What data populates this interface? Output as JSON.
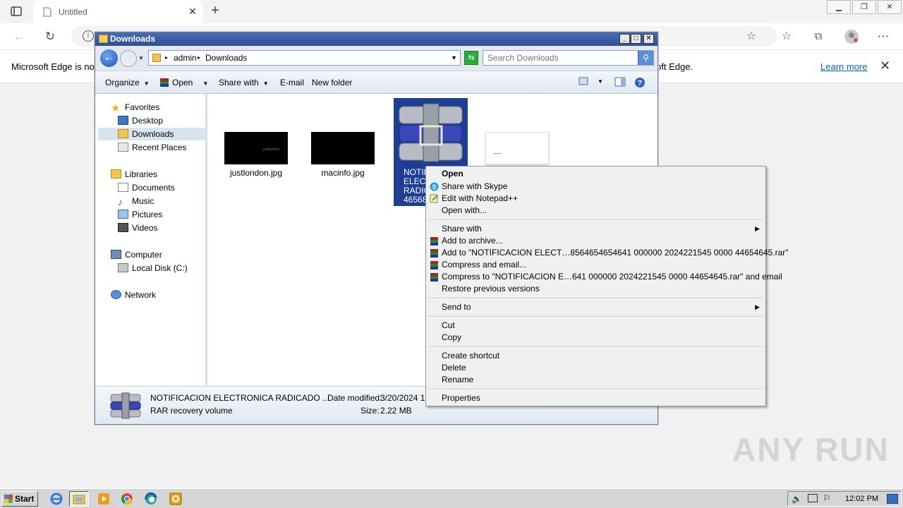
{
  "browser": {
    "tab_title": "Untitled",
    "infobar_left": "Microsoft Edge is no",
    "infobar_right": "oft Edge.",
    "learn_more": "Learn more"
  },
  "explorer": {
    "title": "Downloads",
    "breadcrumb": [
      "admin",
      "Downloads"
    ],
    "search_placeholder": "Search Downloads",
    "commands": {
      "organize": "Organize",
      "open": "Open",
      "share_with": "Share with",
      "email": "E-mail",
      "new_folder": "New folder"
    },
    "nav": {
      "favorites": "Favorites",
      "desktop": "Desktop",
      "downloads": "Downloads",
      "recent_places": "Recent Places",
      "libraries": "Libraries",
      "documents": "Documents",
      "music": "Music",
      "pictures": "Pictures",
      "videos": "Videos",
      "computer": "Computer",
      "local_disk": "Local Disk (C:)",
      "network": "Network"
    },
    "files": [
      {
        "name": "justlondon.jpg",
        "thumb_text": "justlondon"
      },
      {
        "name": "macinfo.jpg"
      },
      {
        "name_lines": [
          "NOTIF",
          "ELECT",
          "RADIC",
          "46568"
        ]
      },
      {
        "name": ""
      }
    ],
    "details": {
      "name": "NOTIFICACION ELECTRONICA RADICADO ...",
      "type": "RAR recovery volume",
      "date_label": "Date modified:",
      "date_value": "3/20/2024 12",
      "size_label": "Size:",
      "size_value": "2.22 MB"
    }
  },
  "context_menu": {
    "open": "Open",
    "share_skype": "Share with Skype",
    "edit_notepad": "Edit with Notepad++",
    "open_with": "Open with...",
    "share_with": "Share with",
    "add_archive": "Add to archive...",
    "add_to_rar": "Add to \"NOTIFICACION ELECT…8564654654641 000000 2024221545 0000 44654645.rar\"",
    "compress_email": "Compress and email...",
    "compress_to_rar_email": "Compress to \"NOTIFICACION E…641 000000 2024221545 0000 44654645.rar\" and email",
    "restore": "Restore previous versions",
    "send_to": "Send to",
    "cut": "Cut",
    "copy": "Copy",
    "create_shortcut": "Create shortcut",
    "delete": "Delete",
    "rename": "Rename",
    "properties": "Properties"
  },
  "taskbar": {
    "start": "Start",
    "clock": "12:02 PM"
  },
  "watermark": "ANY RUN",
  "colors": {
    "title_bar": "#2f4f98",
    "selection": "#1c3f95",
    "link": "#0067b8"
  }
}
